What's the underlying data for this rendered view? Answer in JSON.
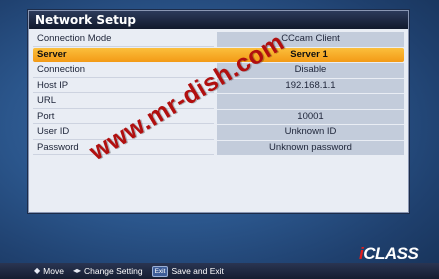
{
  "window": {
    "title": "Network Setup"
  },
  "settings": [
    {
      "label": "Connection Mode",
      "value": "CCcam Client",
      "selected": false
    },
    {
      "label": "Server",
      "value": "Server 1",
      "selected": true
    },
    {
      "label": "Connection",
      "value": "Disable",
      "selected": false
    },
    {
      "label": "Host IP",
      "value": "192.168.1.1",
      "selected": false
    },
    {
      "label": "URL",
      "value": "",
      "selected": false
    },
    {
      "label": "Port",
      "value": "10001",
      "selected": false
    },
    {
      "label": "User ID",
      "value": "Unknown ID",
      "selected": false
    },
    {
      "label": "Password",
      "value": "Unknown password",
      "selected": false
    }
  ],
  "watermark": "www.mr-dish.com",
  "logo": {
    "first": "i",
    "rest": "CLASS"
  },
  "footer": {
    "move_glyph": "◆",
    "move_label": "Move",
    "change_glyph": "◂▸",
    "change_label": "Change Setting",
    "exit_key": "Exit",
    "exit_label": "Save and Exit"
  },
  "colors": {
    "selection": "#f5a623",
    "panel": "#e9edf4",
    "title_bar": "#1b2438",
    "watermark": "#b10f0f"
  }
}
